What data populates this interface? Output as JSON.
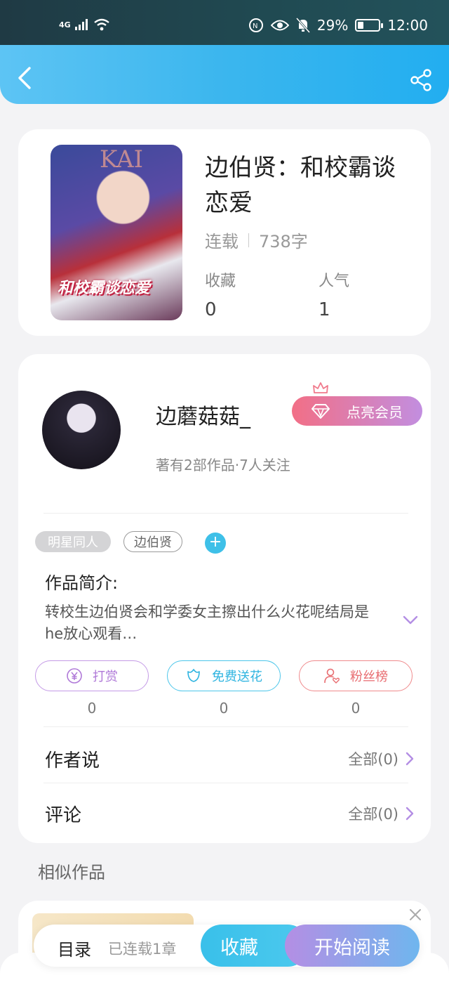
{
  "status_bar": {
    "network": "4G",
    "battery_percent": "29%",
    "battery_level": 0.29,
    "time": "12:00"
  },
  "book": {
    "title": "边伯贤：和校霸谈恋爱",
    "status": "连载",
    "word_count": "738字",
    "cover_text": "和校霸谈恋爱",
    "cover_bg_text": "KAI",
    "favorites_label": "收藏",
    "favorites_value": "0",
    "popularity_label": "人气",
    "popularity_value": "1"
  },
  "author": {
    "name": "边蘑菇菇_",
    "stats": "著有2部作品·7人关注",
    "vip_label": "点亮会员"
  },
  "tags": [
    "明星同人",
    "边伯贤"
  ],
  "tag_add": "+",
  "intro": {
    "heading": "作品简介:",
    "text": "转校生边伯贤会和学委女主擦出什么火花呢结局是he放心观看…"
  },
  "actions": {
    "reward_label": "打赏",
    "reward_count": "0",
    "flower_label": "免费送花",
    "flower_count": "0",
    "fans_label": "粉丝榜",
    "fans_count": "0"
  },
  "author_says": {
    "label": "作者说",
    "link": "全部(0)"
  },
  "comments": {
    "label": "评论",
    "link": "全部(0)"
  },
  "similar": {
    "heading": "相似作品"
  },
  "bottom_bar": {
    "toc_label": "目录",
    "toc_sub": "已连载1章",
    "favorite_button": "收藏",
    "read_button": "开始阅读"
  },
  "colors": {
    "header_start": "#5dc4f4",
    "header_end": "#22aef0",
    "vip_start": "#f26f86",
    "vip_end": "#c28ee0",
    "reward": "#b07ad8",
    "flower": "#2fb4e0",
    "fans": "#e86c70"
  }
}
